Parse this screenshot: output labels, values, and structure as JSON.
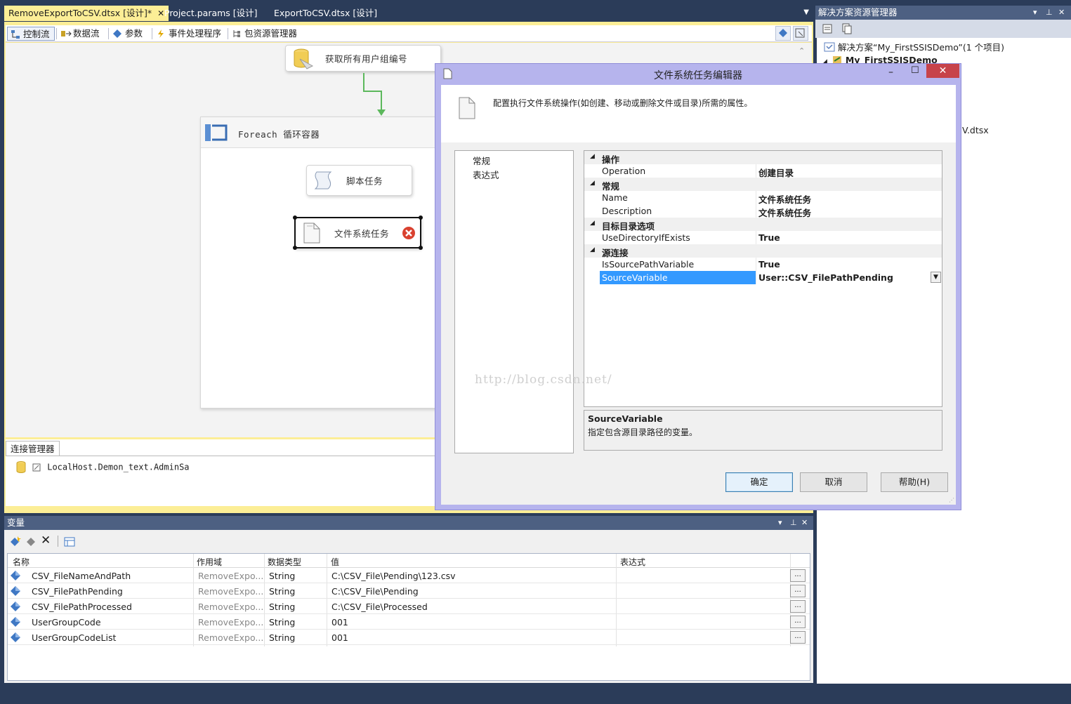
{
  "doc_tabs": [
    {
      "label": "RemoveExportToCSV.dtsx [设计]*",
      "active": true
    },
    {
      "label": "Project.params [设计]"
    },
    {
      "label": "ExportToCSV.dtsx [设计]"
    }
  ],
  "designer_tabs": [
    "控制流",
    "数据流",
    "参数",
    "事件处理程序",
    "包资源管理器"
  ],
  "canvas": {
    "task_top": "获取所有用户组编号",
    "container": "Foreach 循环容器",
    "task_script": "脚本任务",
    "task_fs": "文件系统任务"
  },
  "connection_manager": {
    "tab": "连接管理器",
    "items": [
      "LocalHost.Demon_text.AdminSa"
    ]
  },
  "variables": {
    "title": "变量",
    "columns": [
      "名称",
      "作用域",
      "数据类型",
      "值",
      "表达式"
    ],
    "rows": [
      {
        "name": "CSV_FileNameAndPath",
        "scope": "RemoveExpo...",
        "type": "String",
        "value": "C:\\CSV_File\\Pending\\123.csv",
        "expr": ""
      },
      {
        "name": "CSV_FilePathPending",
        "scope": "RemoveExpo...",
        "type": "String",
        "value": "C:\\CSV_File\\Pending",
        "expr": ""
      },
      {
        "name": "CSV_FilePathProcessed",
        "scope": "RemoveExpo...",
        "type": "String",
        "value": "C:\\CSV_File\\Processed",
        "expr": ""
      },
      {
        "name": "UserGroupCode",
        "scope": "RemoveExpo...",
        "type": "String",
        "value": "001",
        "expr": ""
      },
      {
        "name": "UserGroupCodeList",
        "scope": "RemoveExpo...",
        "type": "String",
        "value": "001",
        "expr": ""
      }
    ],
    "ellipsis": "..."
  },
  "solution_explorer": {
    "title": "解决方案资源管理器",
    "solution": "解决方案“My_FirstSSISDemo”(1 个项目)",
    "project": "My_FirstSSISDemo",
    "partial_file": "V.dtsx"
  },
  "dialog": {
    "title": "文件系统任务编辑器",
    "description": "配置执行文件系统操作(如创建、移动或删除文件或目录)所需的属性。",
    "nav": [
      "常规",
      "表达式"
    ],
    "props": [
      {
        "kind": "cat",
        "name": "操作"
      },
      {
        "kind": "prop",
        "name": "Operation",
        "value": "创建目录"
      },
      {
        "kind": "cat",
        "name": "常规"
      },
      {
        "kind": "prop",
        "name": "Name",
        "value": "文件系统任务"
      },
      {
        "kind": "prop",
        "name": "Description",
        "value": "文件系统任务"
      },
      {
        "kind": "cat",
        "name": "目标目录选项"
      },
      {
        "kind": "prop",
        "name": "UseDirectoryIfExists",
        "value": "True"
      },
      {
        "kind": "cat",
        "name": "源连接"
      },
      {
        "kind": "prop",
        "name": "IsSourcePathVariable",
        "value": "True"
      },
      {
        "kind": "prop",
        "name": "SourceVariable",
        "value": "User::CSV_FilePathPending",
        "selected": true
      }
    ],
    "help_title": "SourceVariable",
    "help_text": "指定包含源目录路径的变量。",
    "buttons": {
      "ok": "确定",
      "cancel": "取消",
      "help": "帮助(H)"
    },
    "watermark": "http://blog.csdn.net/"
  },
  "colors": {
    "chrome": "#2b3c59",
    "panel_title": "#4d6082",
    "active_tab": "#fcee96",
    "dialog_frame": "#b6b4ed",
    "selection": "#3399ff",
    "close_button": "#c7434a"
  }
}
